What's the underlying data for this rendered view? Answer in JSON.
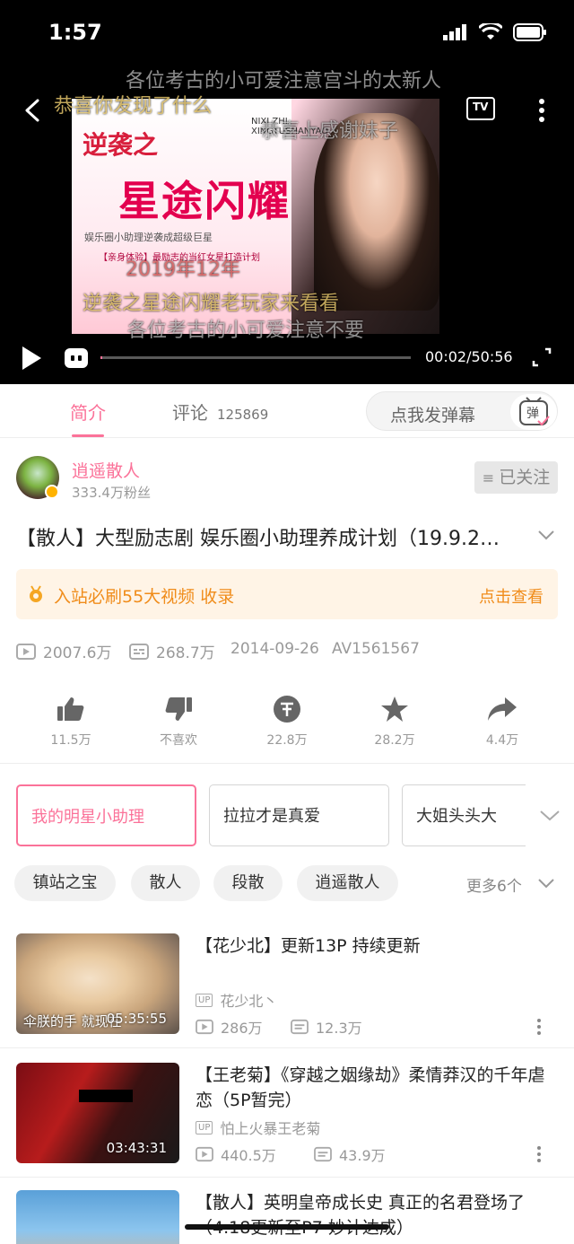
{
  "status_bar": {
    "time": "1:57"
  },
  "player": {
    "poster_title_1": "逆袭之",
    "poster_title_2": "星途闪耀",
    "poster_pinyin": "NIXI ZHI XINGTUSHANYAO",
    "poster_sub": "娱乐圈小助理逆袭成超级巨星",
    "poster_sub2": "【亲身体验】最励志的当红女星打造计划",
    "danmaku": [
      "各位考古的小可爱注意宫斗的太新人",
      "恭喜你发现了什么",
      "恭喜上感谢妹子",
      "逆袭之星途闪耀老玩家来看看",
      "各位考古的小可爱注意不要",
      "2019年12年"
    ],
    "time_display": "00:02/50:56",
    "progress": 0.0007
  },
  "tabs": {
    "intro": "简介",
    "comments": "评论",
    "comment_count": "125869",
    "danmaku_placeholder": "点我发弹幕",
    "danmaku_icon_char": "弹"
  },
  "uploader": {
    "name": "逍遥散人",
    "fans": "333.4万粉丝",
    "follow_label": "已关注"
  },
  "video": {
    "title": "【散人】大型励志剧 娱乐圈小助理养成计划（19.9.2…"
  },
  "banner": {
    "text": "入站必刷55大视频 收录",
    "link": "点击查看"
  },
  "stats": {
    "plays": "2007.6万",
    "danmaku": "268.7万",
    "date": "2014-09-26",
    "av": "AV1561567"
  },
  "actions": [
    {
      "label": "11.5万",
      "icon": "thumbs-up-icon"
    },
    {
      "label": "不喜欢",
      "icon": "thumbs-down-icon"
    },
    {
      "label": "22.8万",
      "icon": "coin-icon"
    },
    {
      "label": "28.2万",
      "icon": "star-icon"
    },
    {
      "label": "4.4万",
      "icon": "share-icon"
    }
  ],
  "parts": [
    "我的明星小助理",
    "拉拉才是真爱",
    "大姐头头大"
  ],
  "tags": [
    "镇站之宝",
    "散人",
    "段散",
    "逍遥散人"
  ],
  "tags_more": "更多6个",
  "recommendations": [
    {
      "title": "【花少北】更新13P 持续更新",
      "duration": "05:35:55",
      "thumb_caption": "伞朕的手 就现在",
      "up": "花少北丶",
      "plays": "286万",
      "danmaku": "12.3万"
    },
    {
      "title": "【王老菊】《穿越之姻缘劫》柔情莽汉的千年虐恋（5P暂完）",
      "duration": "03:43:31",
      "up": "怕上火暴王老菊",
      "plays": "440.5万",
      "danmaku": "43.9万"
    },
    {
      "title": "【散人】英明皇帝成长史 真正的名君登场了（4.18更新至P7 妙计达成）"
    }
  ],
  "colors": {
    "accent": "#fb7299",
    "banner_text": "#f08c1a"
  }
}
